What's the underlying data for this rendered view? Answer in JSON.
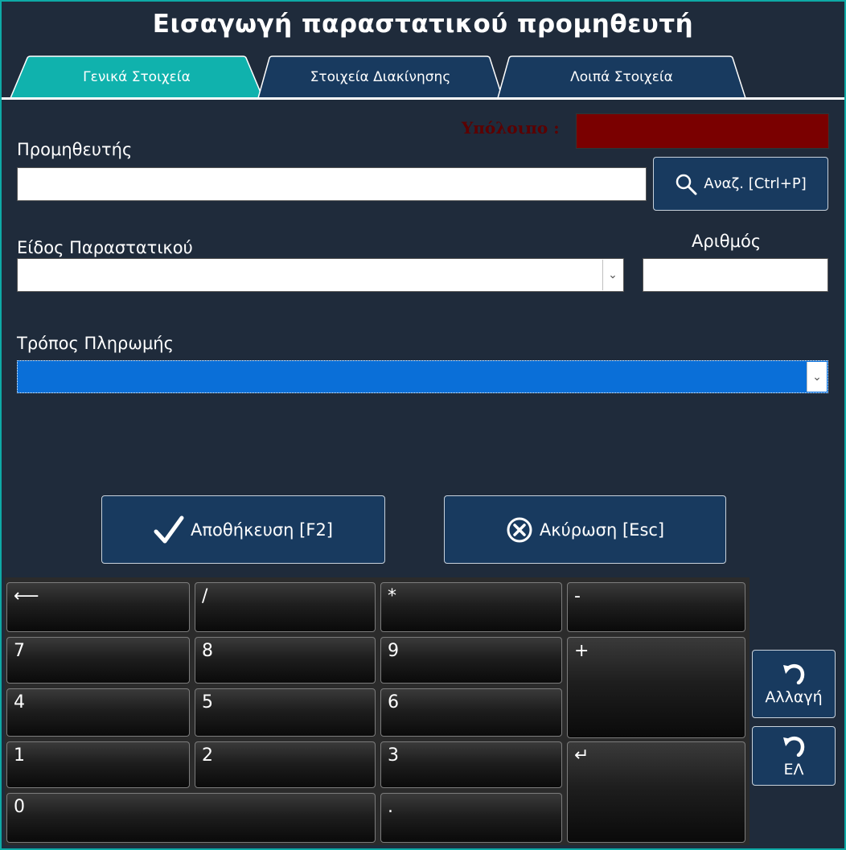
{
  "window": {
    "title": "Εισαγωγή παραστατικού προμηθευτή",
    "accent": "#0eaaa6",
    "background": "#1f2b3b"
  },
  "tabs": [
    {
      "label": "Γενικά Στοιχεία",
      "active": true
    },
    {
      "label": "Στοιχεία Διακίνησης",
      "active": false
    },
    {
      "label": "Λοιπά Στοιχεία",
      "active": false
    }
  ],
  "form": {
    "balance_label": "Υπόλοιπο :",
    "supplier_label": "Προμηθευτής",
    "supplier_value": "",
    "search_label": "Αναζ. [Ctrl+P]",
    "doc_type_label": "Είδος Παραστατικού",
    "doc_type_value": "",
    "number_label": "Αριθμός",
    "number_value": "",
    "payment_label": "Τρόπος Πληρωμής",
    "payment_value": ""
  },
  "actions": {
    "save_label": "Αποθήκευση [F2]",
    "cancel_label": "Ακύρωση [Esc]"
  },
  "keypad": {
    "backspace": "⟵",
    "divide": "/",
    "multiply": "*",
    "minus": "-",
    "k7": "7",
    "k8": "8",
    "k9": "9",
    "plus": "+",
    "k4": "4",
    "k5": "5",
    "k6": "6",
    "k1": "1",
    "k2": "2",
    "k3": "3",
    "enter": "↵",
    "k0": "0",
    "dot": "."
  },
  "side": {
    "change_label": "Αλλαγή",
    "lang_label": "ΕΛ"
  }
}
